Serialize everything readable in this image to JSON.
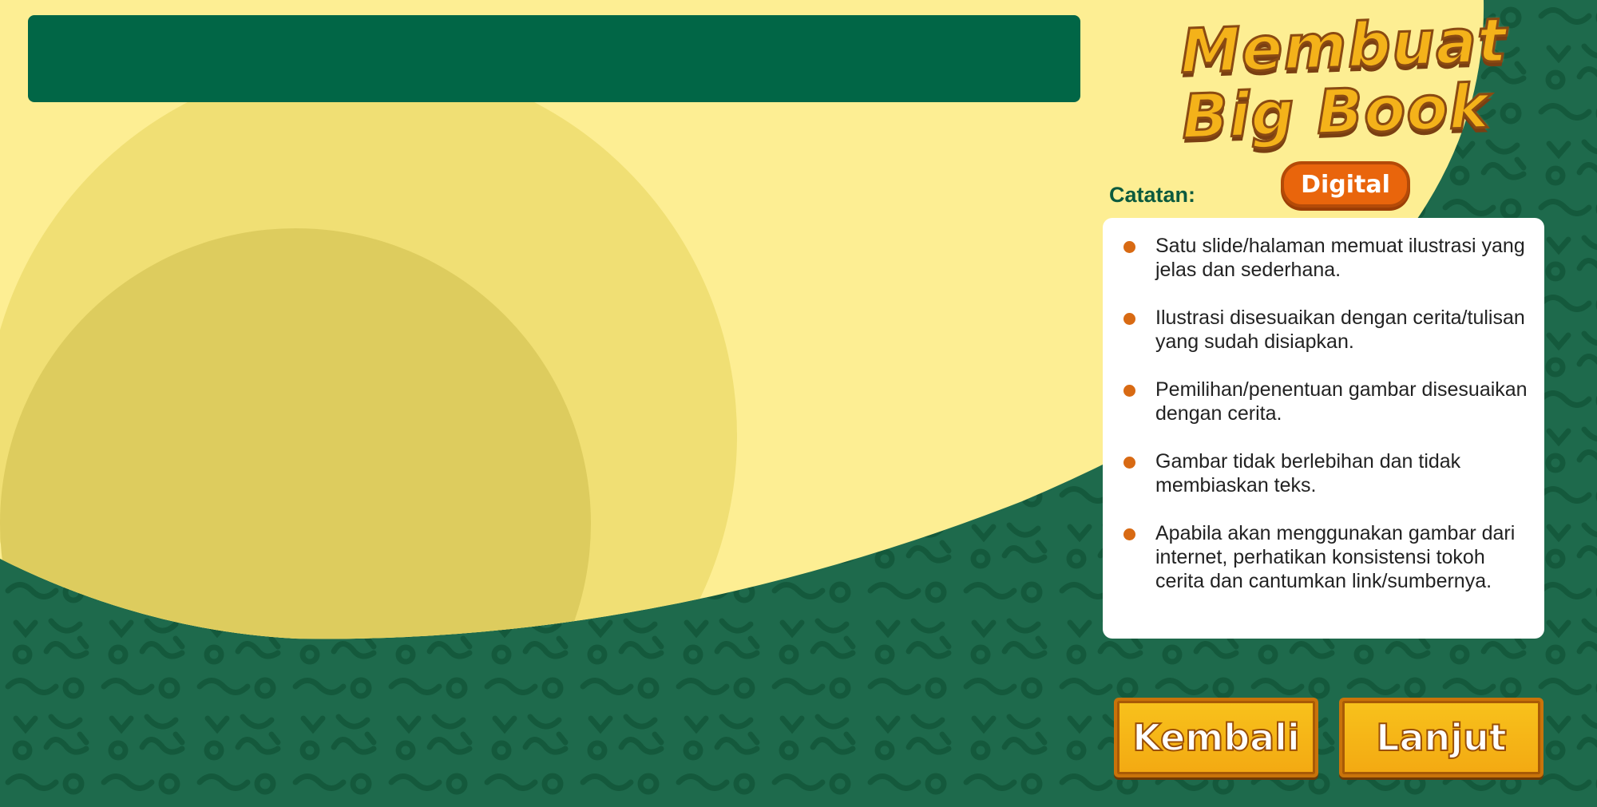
{
  "logo": {
    "title_line1": "Membuat",
    "title_line2": "Big Book",
    "badge": "Digital"
  },
  "notes": {
    "label": "Catatan:",
    "items": [
      "Satu slide/halaman memuat ilustrasi yang jelas dan sederhana.",
      "Ilustrasi disesuaikan dengan cerita/tulisan yang sudah disiapkan.",
      "Pemilihan/penentuan gambar disesuaikan dengan cerita.",
      "Gambar tidak berlebihan dan tidak membiaskan teks.",
      "Apabila akan menggunakan gambar dari internet, perhatikan konsistensi tokoh cerita dan cantumkan link/sumbernya."
    ]
  },
  "buttons": {
    "back_label": "Kembali",
    "next_label": "Lanjut"
  },
  "colors": {
    "green_dark": "#016646",
    "green_pattern": "#1e6a4c",
    "cream": "#fdee93",
    "yellow_mid": "#f0df74",
    "yellow_deep": "#ddcc5e",
    "orange": "#e9650c",
    "button_yellow": "#f8c21c"
  }
}
